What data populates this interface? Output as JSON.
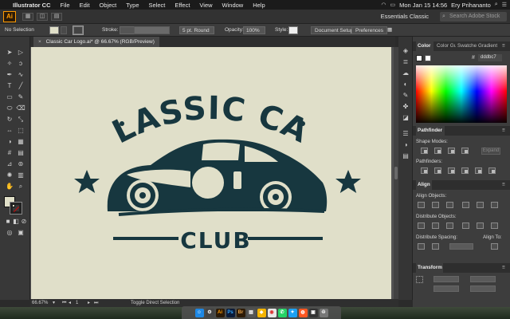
{
  "menubar": {
    "app_name": "Illustrator CC",
    "items": [
      "File",
      "Edit",
      "Object",
      "Type",
      "Select",
      "Effect",
      "View",
      "Window",
      "Help"
    ],
    "clock": "Mon Jan 15  14:56",
    "user": "Ery Prihananto"
  },
  "appbar": {
    "logo": "Ai",
    "workspace": "Essentials Classic",
    "search_placeholder": "Search Adobe Stock"
  },
  "controlbar": {
    "selection": "No Selection",
    "stroke_label": "Stroke:",
    "brush": "5 pt. Round",
    "opacity_label": "Opacity:",
    "opacity_value": "100%",
    "style_label": "Style:",
    "doc_setup": "Document Setup",
    "preferences": "Preferences"
  },
  "document": {
    "tab_title": "Classic Car Logo.ai* @ 66.67% (RGB/Preview)",
    "tab_close": "×"
  },
  "artwork": {
    "line1": "CLASSIC CAR",
    "line2": "CLUB",
    "ink_color": "#17373f",
    "bg_color": "#e0dfc9"
  },
  "statusbar": {
    "zoom": "66.67%",
    "artboard": "1",
    "tool": "Toggle Direct Selection"
  },
  "panels": {
    "color_tabs": [
      "Color",
      "Color Gu",
      "Swatche",
      "Gradient"
    ],
    "hex": "dddbc7",
    "pathfinder": {
      "title": "Pathfinder",
      "shape_modes": "Shape Modes:",
      "pathfinders": "Pathfinders:",
      "expand": "Expand"
    },
    "align": {
      "title": "Align",
      "align_objects": "Align Objects:",
      "distribute_objects": "Distribute Objects:",
      "distribute_spacing": "Distribute Spacing:",
      "align_to": "Align To:"
    },
    "transform": {
      "title": "Transform"
    }
  }
}
